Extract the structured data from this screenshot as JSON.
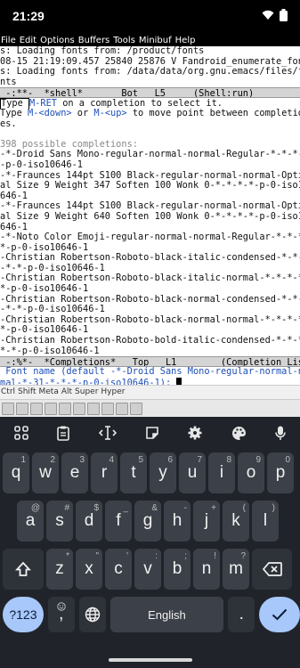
{
  "status": {
    "time": "21:29"
  },
  "emacs": {
    "menu": [
      "File",
      "Edit",
      "Options",
      "Buffers",
      "Tools",
      "Minibuf",
      "Help"
    ],
    "messages": [
      "s: Loading fonts from: /product/fonts",
      "08-15 21:19:09.457 25840 25876 V Fandroid_enumerate_font",
      "s: Loading fonts from: /data/data/org.gnu.emacs/files/fo",
      "nts"
    ],
    "modeline_shell": " -:**-  *shell*       Bot   L5     (Shell:run)",
    "help": {
      "line1_pre": "Type ",
      "line1_key": "M-RET",
      "line1_post": " on a completion to select it.",
      "line2_pre": "Type ",
      "line2_key1": "M-<down>",
      "line2_mid": " or ",
      "line2_key2": "M-<up>",
      "line2_post": " to move point between completion",
      "line3": "es."
    },
    "possible": "398 possible completions:",
    "completions": [
      "-*-Droid Sans Mono-regular-normal-normal-Regular-*-*-*-*",
      "-p-0-iso10646-1",
      "-*-Fraunces 144pt S100 Black-regular-normal-normal-Optic",
      "al Size 9 Weight 347 Soften 100 Wonk 0-*-*-*-*-p-0-iso10",
      "646-1",
      "-*-Fraunces 144pt S100 Black-regular-normal-normal-Optic",
      "al Size 9 Weight 640 Soften 100 Wonk 0-*-*-*-*-p-0-iso10",
      "646-1",
      "-*-Noto Color Emoji-regular-normal-normal-Regular-*-*-*-",
      "*-p-0-iso10646-1",
      "-Christian Robertson-Roboto-black-italic-condensed-*-*-*",
      "-*-*-p-0-iso10646-1",
      "-Christian Robertson-Roboto-black-italic-normal-*-*-*-*-",
      "*-p-0-iso10646-1",
      "-Christian Robertson-Roboto-black-normal-condensed-*-*-*",
      "-*-*-p-0-iso10646-1",
      "-Christian Robertson-Roboto-black-normal-normal-*-*-*-*-",
      "*-p-0-iso10646-1",
      "-Christian Robertson-Roboto-bold-italic-condensed-*-*-*-",
      "*-*-p-0-iso10646-1"
    ],
    "modeline_completions": " -:%*-  *Completions*   Top   L1        (Completion List)",
    "minibuf_prompt": " Font name (default -*-Droid Sans Mono-regular-normal-nor",
    "minibuf_prompt2": "mal-*-31-*-*-*-p-0-iso10646-1): ",
    "toolstrip": [
      "Ctrl",
      "Shift",
      "Meta",
      "Alt",
      "Super",
      "Hyper"
    ]
  },
  "keyboard": {
    "row1": [
      {
        "k": "q",
        "s": "1"
      },
      {
        "k": "w",
        "s": "2"
      },
      {
        "k": "e",
        "s": "3"
      },
      {
        "k": "r",
        "s": "4"
      },
      {
        "k": "t",
        "s": "5"
      },
      {
        "k": "y",
        "s": "6"
      },
      {
        "k": "u",
        "s": "7"
      },
      {
        "k": "i",
        "s": "8"
      },
      {
        "k": "o",
        "s": "9"
      },
      {
        "k": "p",
        "s": "0"
      }
    ],
    "row2": [
      {
        "k": "a",
        "s": "@"
      },
      {
        "k": "s",
        "s": "#"
      },
      {
        "k": "d",
        "s": "$"
      },
      {
        "k": "f",
        "s": "_"
      },
      {
        "k": "g",
        "s": "&"
      },
      {
        "k": "h",
        "s": "-"
      },
      {
        "k": "j",
        "s": "+"
      },
      {
        "k": "k",
        "s": "("
      },
      {
        "k": "l",
        "s": ")"
      }
    ],
    "row3": [
      {
        "k": "z",
        "s": "*"
      },
      {
        "k": "x",
        "s": "\""
      },
      {
        "k": "c",
        "s": "'"
      },
      {
        "k": "v",
        "s": ":"
      },
      {
        "k": "b",
        "s": ";"
      },
      {
        "k": "n",
        "s": "!"
      },
      {
        "k": "m",
        "s": "?"
      }
    ],
    "symbols_label": "?123",
    "comma_label": ",",
    "space_label": "English",
    "period_label": "."
  },
  "icons": [
    "apps-grid-icon",
    "clipboard-icon",
    "text-cursor-icon",
    "sticker-icon",
    "settings-gear-icon",
    "palette-icon",
    "microphone-icon",
    "shift-arrow-icon",
    "backspace-icon",
    "emoji-icon",
    "globe-icon",
    "enter-check-icon",
    "wifi-icon",
    "battery-icon"
  ]
}
